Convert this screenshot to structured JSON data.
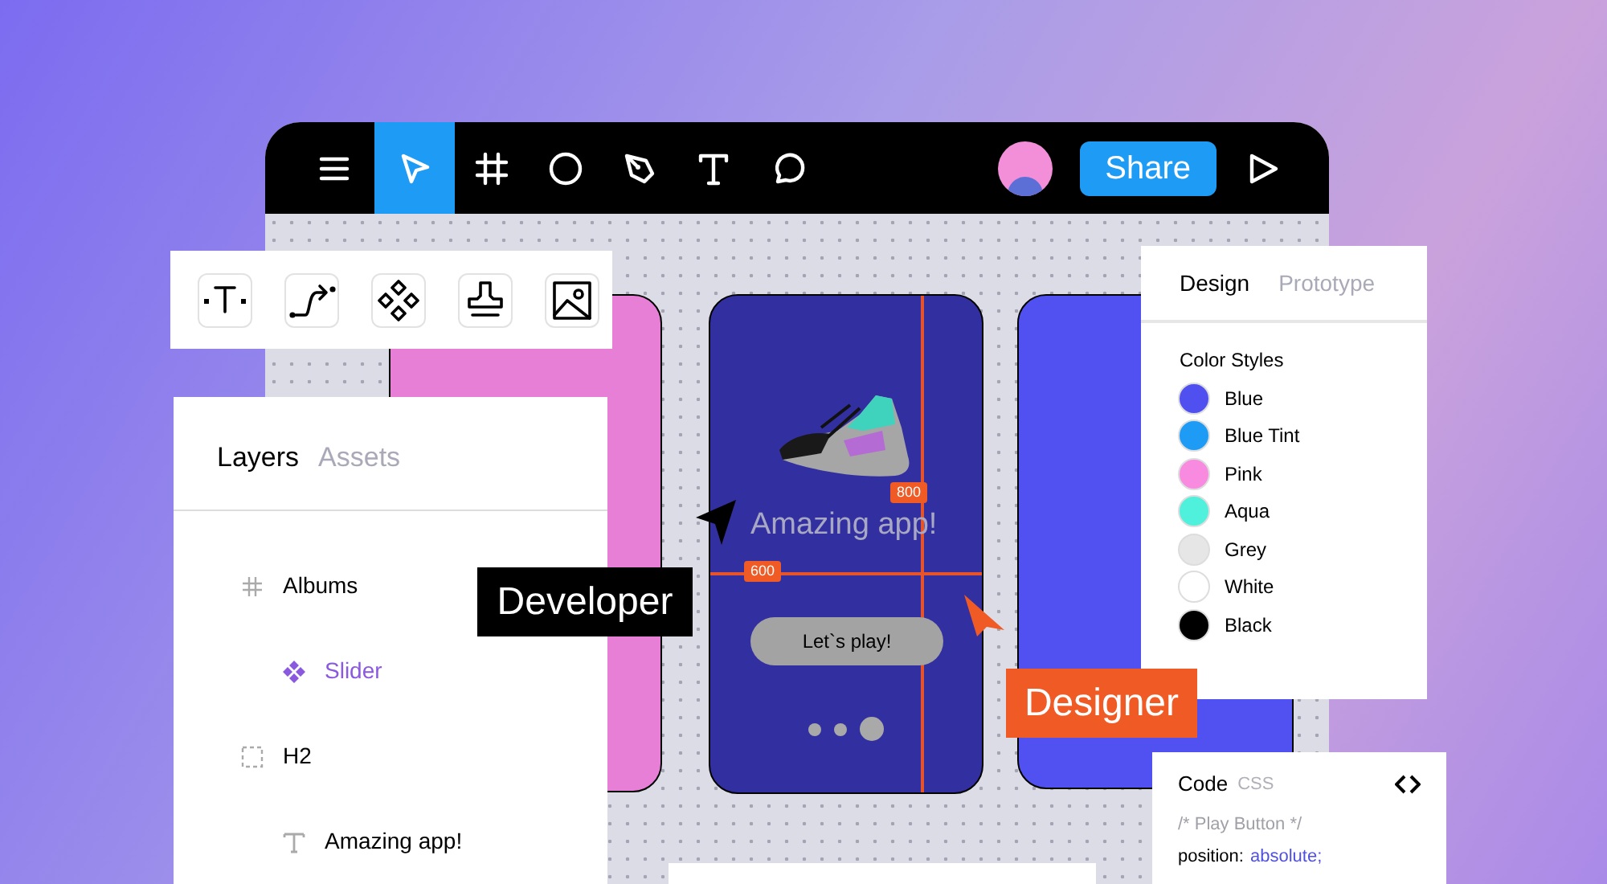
{
  "toolbar": {
    "tools": [
      {
        "kind": "menu",
        "selected": false
      },
      {
        "kind": "pointer",
        "selected": true
      },
      {
        "kind": "frame",
        "selected": false
      },
      {
        "kind": "ellipse",
        "selected": false
      },
      {
        "kind": "pen",
        "selected": false
      },
      {
        "kind": "text",
        "selected": false
      },
      {
        "kind": "comment",
        "selected": false
      }
    ],
    "share_button": "Share"
  },
  "palette": {
    "tools": [
      {
        "kind": "text"
      },
      {
        "kind": "connector"
      },
      {
        "kind": "component"
      },
      {
        "kind": "stamp"
      },
      {
        "kind": "image"
      }
    ]
  },
  "layers_panel": {
    "tabs": [
      {
        "label": "Layers",
        "selected": true
      },
      {
        "label": "Assets",
        "selected": false
      }
    ],
    "items": [
      {
        "kind": "frame",
        "label": "Albums",
        "children": [
          {
            "kind": "component",
            "label": "Slider"
          }
        ]
      },
      {
        "kind": "group",
        "label": "H2",
        "children": [
          {
            "kind": "text",
            "label": "Amazing app!"
          }
        ]
      }
    ]
  },
  "canvas": {
    "phones": [
      {
        "color": "#e77fd6"
      },
      {
        "color": "#3230a0"
      },
      {
        "color": "#5151f2"
      }
    ],
    "screen": {
      "title": "Amazing app!",
      "button": "Let`s play!",
      "dots": [
        {
          "selected": false
        },
        {
          "selected": false
        },
        {
          "selected": true
        }
      ]
    },
    "measures": [
      "800",
      "600"
    ]
  },
  "labels": [
    {
      "text": "Developer",
      "color": "#000000"
    },
    {
      "text": "Designer",
      "color": "#f05a24"
    }
  ],
  "design_panel": {
    "tabs": [
      {
        "label": "Design",
        "selected": true
      },
      {
        "label": "Prototype",
        "selected": false
      }
    ],
    "section": "Color Styles",
    "colors": [
      {
        "label": "Blue",
        "color": "#5050f0"
      },
      {
        "label": "Blue Tint",
        "color": "#1e9cf5"
      },
      {
        "label": "Pink",
        "color": "#f88ae0"
      },
      {
        "label": "Aqua",
        "color": "#4ff0dc"
      },
      {
        "label": "Grey",
        "color": "#e6e6e6"
      },
      {
        "label": "White",
        "color": "#ffffff"
      },
      {
        "label": "Black",
        "color": "#000000"
      }
    ]
  },
  "code_panel": {
    "title": "Code",
    "language": "CSS",
    "comment": "/* Play Button */",
    "lines": [
      {
        "property": "position:",
        "value": "absolute;"
      }
    ]
  }
}
